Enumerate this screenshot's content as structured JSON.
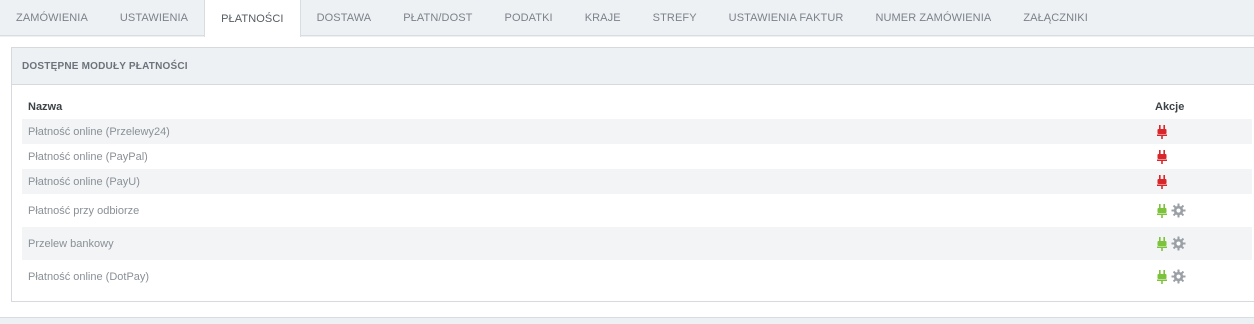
{
  "tabs": [
    {
      "label": "ZAMÓWIENIA"
    },
    {
      "label": "USTAWIENIA"
    },
    {
      "label": "PŁATNOŚCI"
    },
    {
      "label": "DOSTAWA"
    },
    {
      "label": "PŁATN/DOST"
    },
    {
      "label": "PODATKI"
    },
    {
      "label": "KRAJE"
    },
    {
      "label": "STREFY"
    },
    {
      "label": "USTAWIENIA FAKTUR"
    },
    {
      "label": "NUMER ZAMÓWIENIA"
    },
    {
      "label": "ZAŁĄCZNIKI"
    }
  ],
  "active_tab": "PŁATNOŚCI",
  "panel": {
    "title": "DOSTĘPNE MODUŁY PŁATNOŚCI",
    "columns": {
      "name": "Nazwa",
      "actions": "Akcje"
    },
    "rows": [
      {
        "name": "Płatność online (Przelewy24)",
        "status": "disabled",
        "plug_icon": "red-plug-icon",
        "has_settings": false
      },
      {
        "name": "Płatność online (PayPal)",
        "status": "disabled",
        "plug_icon": "red-plug-icon",
        "has_settings": false
      },
      {
        "name": "Płatność online (PayU)",
        "status": "disabled",
        "plug_icon": "red-plug-icon",
        "has_settings": false
      },
      {
        "name": "Płatność przy odbiorze",
        "status": "enabled",
        "plug_icon": "green-plug-icon",
        "has_settings": true
      },
      {
        "name": "Przelew bankowy",
        "status": "enabled",
        "plug_icon": "green-plug-icon",
        "has_settings": true
      },
      {
        "name": "Płatność online (DotPay)",
        "status": "enabled",
        "plug_icon": "green-plug-icon",
        "has_settings": true
      }
    ]
  },
  "colors": {
    "plug_disabled": "#d9262a",
    "plug_enabled": "#7cc23a",
    "gear": "#9aa0a6"
  }
}
